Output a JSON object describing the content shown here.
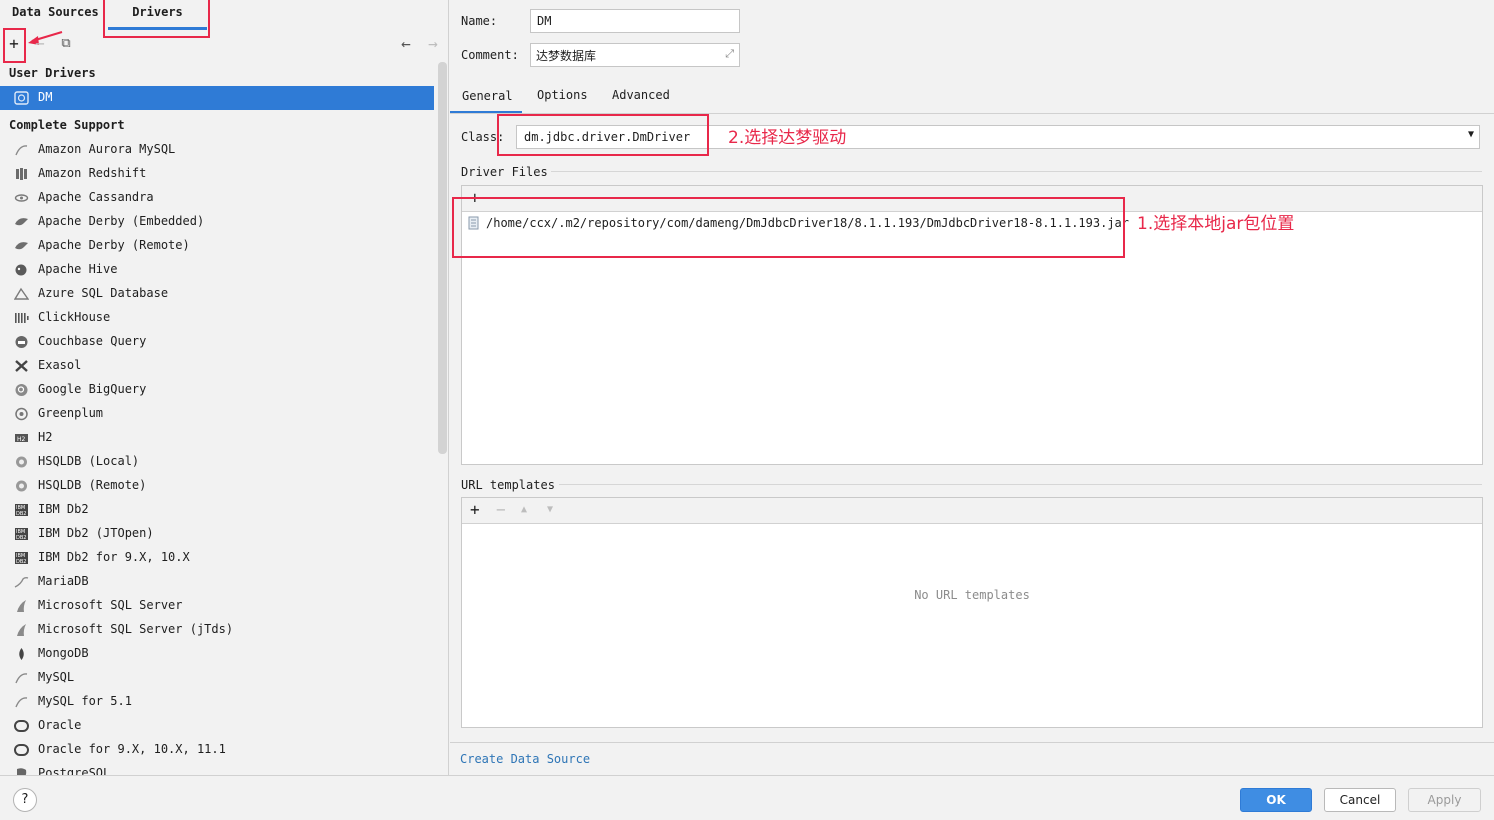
{
  "tabs": {
    "data_sources": "Data Sources",
    "drivers": "Drivers"
  },
  "toolbar": {
    "add": "+",
    "remove": "−",
    "duplicate": "⧉",
    "back": "←",
    "forward": "→"
  },
  "user_drivers_header": "User Drivers",
  "user_drivers": [
    {
      "label": "DM",
      "icon": "dm-icon"
    }
  ],
  "complete_support_header": "Complete Support",
  "drivers": [
    {
      "label": "Amazon Aurora MySQL",
      "icon": "dolphin-icon"
    },
    {
      "label": "Amazon Redshift",
      "icon": "redshift-icon"
    },
    {
      "label": "Apache Cassandra",
      "icon": "cassandra-icon"
    },
    {
      "label": "Apache Derby (Embedded)",
      "icon": "derby-icon"
    },
    {
      "label": "Apache Derby (Remote)",
      "icon": "derby-icon"
    },
    {
      "label": "Apache Hive",
      "icon": "hive-icon"
    },
    {
      "label": "Azure SQL Database",
      "icon": "azure-icon"
    },
    {
      "label": "ClickHouse",
      "icon": "clickhouse-icon"
    },
    {
      "label": "Couchbase Query",
      "icon": "couchbase-icon"
    },
    {
      "label": "Exasol",
      "icon": "exasol-icon"
    },
    {
      "label": "Google BigQuery",
      "icon": "bigquery-icon"
    },
    {
      "label": "Greenplum",
      "icon": "greenplum-icon"
    },
    {
      "label": "H2",
      "icon": "h2-icon"
    },
    {
      "label": "HSQLDB (Local)",
      "icon": "hsqldb-icon"
    },
    {
      "label": "HSQLDB (Remote)",
      "icon": "hsqldb-icon"
    },
    {
      "label": "IBM Db2",
      "icon": "ibm-icon"
    },
    {
      "label": "IBM Db2 (JTOpen)",
      "icon": "ibm-icon"
    },
    {
      "label": "IBM Db2 for 9.X, 10.X",
      "icon": "ibm-icon"
    },
    {
      "label": "MariaDB",
      "icon": "mariadb-icon"
    },
    {
      "label": "Microsoft SQL Server",
      "icon": "sqlserver-icon"
    },
    {
      "label": "Microsoft SQL Server (jTds)",
      "icon": "sqlserver-icon"
    },
    {
      "label": "MongoDB",
      "icon": "mongodb-icon"
    },
    {
      "label": "MySQL",
      "icon": "dolphin-icon"
    },
    {
      "label": "MySQL for 5.1",
      "icon": "dolphin-icon"
    },
    {
      "label": "Oracle",
      "icon": "oracle-icon"
    },
    {
      "label": "Oracle for 9.X, 10.X, 11.1",
      "icon": "oracle-icon"
    },
    {
      "label": "PostgreSQL",
      "icon": "postgres-icon"
    }
  ],
  "form": {
    "name_label": "Name:",
    "name_value": "DM",
    "comment_label": "Comment:",
    "comment_value": "达梦数据库",
    "tabs": [
      "General",
      "Options",
      "Advanced"
    ],
    "class_label": "Class:",
    "class_value": "dm.jdbc.driver.DmDriver",
    "driver_files_label": "Driver Files",
    "driver_file_path": "/home/ccx/.m2/repository/com/dameng/DmJdbcDriver18/8.1.1.193/DmJdbcDriver18-8.1.1.193.jar",
    "url_templates_label": "URL templates",
    "no_url_templates": "No URL templates",
    "create_data_source": "Create Data Source"
  },
  "annotations": {
    "select_driver": "2.选择达梦驱动",
    "select_jar": "1.选择本地jar包位置"
  },
  "footer": {
    "help": "?",
    "ok": "OK",
    "cancel": "Cancel",
    "apply": "Apply"
  },
  "colors": {
    "accent": "#2f7bd6",
    "annotation": "#e8284a",
    "link": "#2e75b6"
  }
}
